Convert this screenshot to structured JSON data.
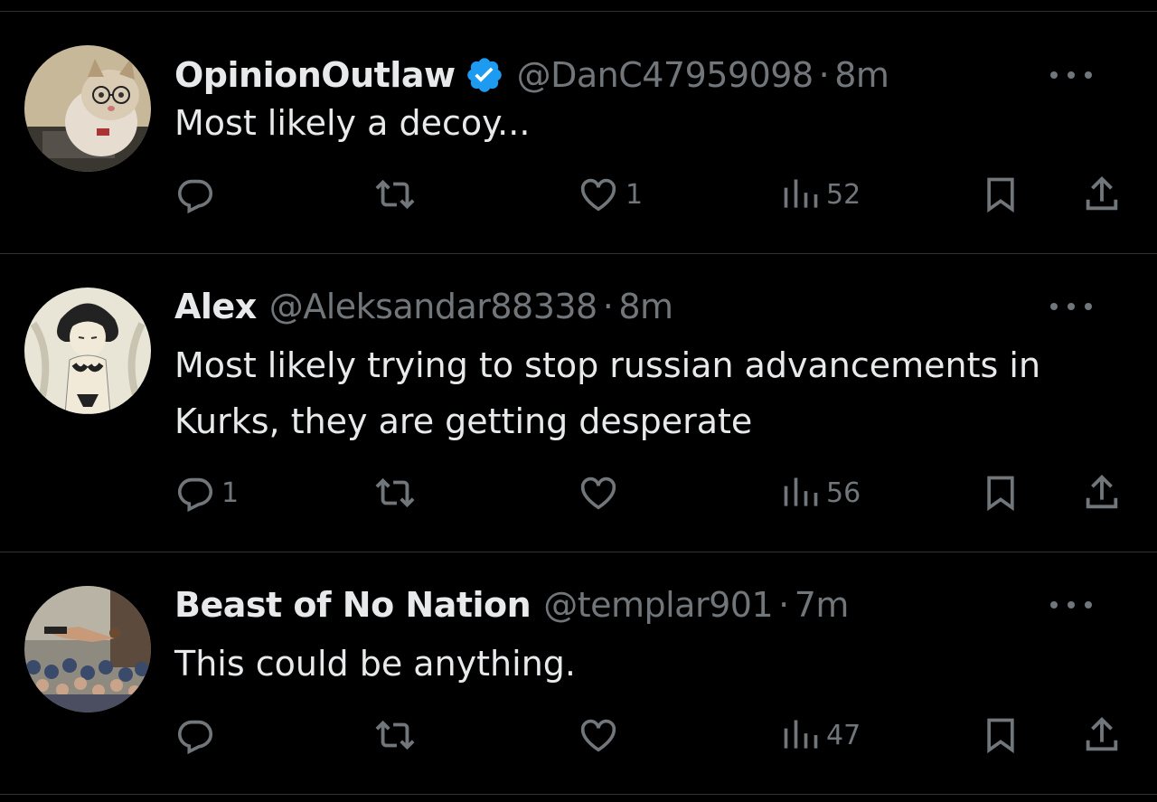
{
  "colors": {
    "background": "#000000",
    "text_primary": "#e7e9ea",
    "text_secondary": "#71767b",
    "divider": "#2f3336",
    "verified": "#1d9bf0"
  },
  "tweets": [
    {
      "display_name": "OpinionOutlaw",
      "verified": true,
      "handle": "@DanC47959098",
      "separator": "·",
      "time": "8m",
      "text": "Most likely a decoy...",
      "avatar": "cat-with-glasses-avatar",
      "replies": "",
      "retweets": "",
      "likes": "1",
      "views": "52"
    },
    {
      "display_name": "Alex",
      "verified": false,
      "handle": "@Aleksandar88338",
      "separator": "·",
      "time": "8m",
      "text": "Most likely trying to stop russian advancements in Kurks, they are getting desperate",
      "avatar": "anime-sketch-avatar",
      "replies": "1",
      "retweets": "",
      "likes": "",
      "views": "56"
    },
    {
      "display_name": "Beast of No Nation",
      "verified": false,
      "handle": "@templar901",
      "separator": "·",
      "time": "7m",
      "text": "This could be anything.",
      "avatar": "crowd-stage-dive-avatar",
      "replies": "",
      "retweets": "",
      "likes": "",
      "views": "47"
    }
  ],
  "icons": {
    "reply": "reply-icon",
    "retweet": "retweet-icon",
    "like": "like-icon",
    "views": "views-icon",
    "bookmark": "bookmark-icon",
    "share": "share-icon",
    "more": "more-icon",
    "verified": "verified-badge-icon"
  }
}
